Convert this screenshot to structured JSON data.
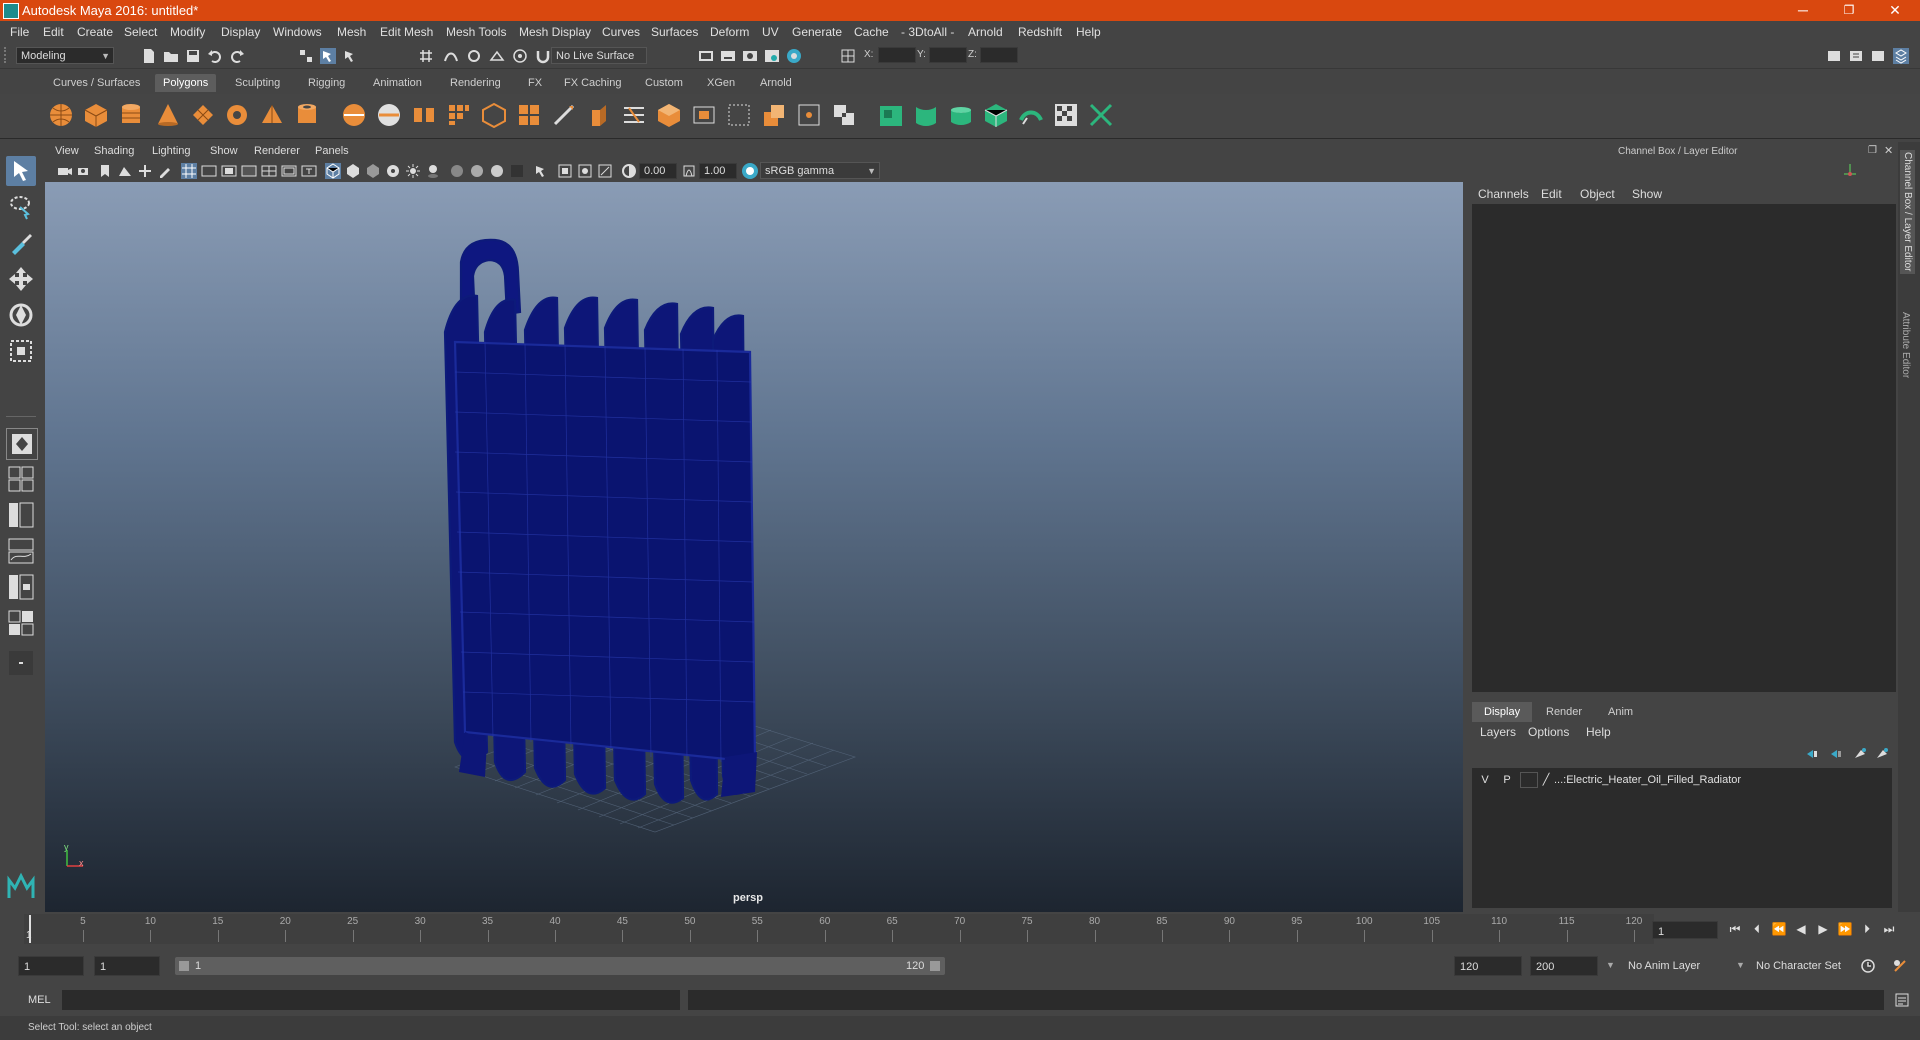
{
  "window": {
    "title": "Autodesk Maya 2016: untitled*",
    "minimize": "─",
    "restore": "❐",
    "close": "✕"
  },
  "menubar": [
    "File",
    "Edit",
    "Create",
    "Select",
    "Modify",
    "Display",
    "Windows",
    "Mesh",
    "Edit Mesh",
    "Mesh Tools",
    "Mesh Display",
    "Curves",
    "Surfaces",
    "Deform",
    "UV",
    "Generate",
    "Cache",
    "- 3DtoAll -",
    "Arnold",
    "Redshift",
    "Help"
  ],
  "statusline": {
    "mode": "Modeling",
    "live_surface": "No Live Surface",
    "x_label": "X:",
    "y_label": "Y:",
    "z_label": "Z:"
  },
  "shelf_tabs": [
    "Curves / Surfaces",
    "Polygons",
    "Sculpting",
    "Rigging",
    "Animation",
    "Rendering",
    "FX",
    "FX Caching",
    "Custom",
    "XGen",
    "Arnold"
  ],
  "active_shelf_tab": "Polygons",
  "viewport": {
    "menus": [
      "View",
      "Shading",
      "Lighting",
      "Show",
      "Renderer",
      "Panels"
    ],
    "exposure": "0.00",
    "gamma": "1.00",
    "color_space": "sRGB gamma",
    "camera": "persp",
    "axis_y": "y",
    "axis_x": "x"
  },
  "channel_box": {
    "title": "Channel Box / Layer Editor",
    "menus": [
      "Channels",
      "Edit",
      "Object",
      "Show"
    ]
  },
  "layer_editor": {
    "tabs": [
      "Display",
      "Render",
      "Anim"
    ],
    "active_tab": "Display",
    "menus": [
      "Layers",
      "Options",
      "Help"
    ],
    "layers": [
      {
        "visible": "V",
        "playback": "P",
        "name": "...:Electric_Heater_Oil_Filled_Radiator"
      }
    ]
  },
  "side_tabs": [
    "Channel Box / Layer Editor",
    "Attribute Editor"
  ],
  "timeline": {
    "ticks": [
      "5",
      "10",
      "15",
      "20",
      "25",
      "30",
      "35",
      "40",
      "45",
      "50",
      "55",
      "60",
      "65",
      "70",
      "75",
      "80",
      "85",
      "90",
      "95",
      "100",
      "105",
      "110",
      "115",
      "120"
    ],
    "start_tick": "1",
    "current_frame": "1"
  },
  "range": {
    "start": "1",
    "playback_start": "1",
    "slider_start": "1",
    "slider_end": "120",
    "playback_end": "120",
    "end": "200",
    "anim_layer": "No Anim Layer",
    "character_set": "No Character Set"
  },
  "command_line": {
    "label": "MEL"
  },
  "help_line": "Select Tool: select an object"
}
